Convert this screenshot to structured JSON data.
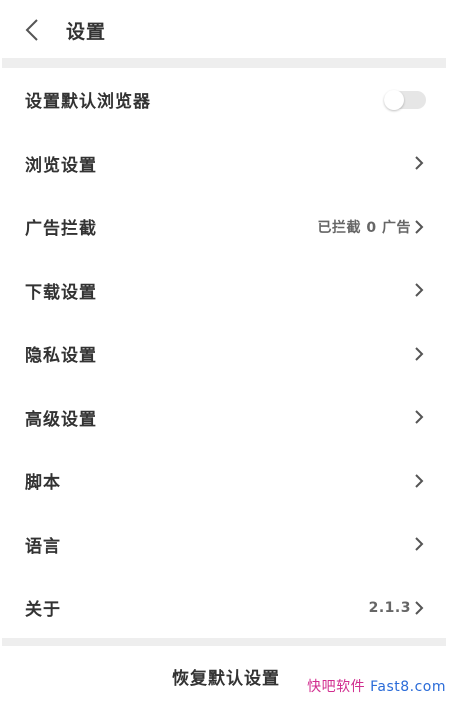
{
  "header": {
    "title": "设置"
  },
  "settings": {
    "items": [
      {
        "label": "设置默认浏览器"
      },
      {
        "label": "浏览设置"
      },
      {
        "label": "广告拦截",
        "value": "已拦截 0 广告"
      },
      {
        "label": "下载设置"
      },
      {
        "label": "隐私设置"
      },
      {
        "label": "高级设置"
      },
      {
        "label": "脚本"
      },
      {
        "label": "语言"
      },
      {
        "label": "关于",
        "value": "2.1.3"
      }
    ],
    "default_browser_toggle": "off"
  },
  "footer": {
    "reset_label": "恢复默认设置"
  },
  "watermark": {
    "part1": "快吧软件",
    "part2": " Fast8.com"
  },
  "colors": {
    "divider": "#eeeeee",
    "text": "#333333",
    "secondary": "#666666"
  }
}
